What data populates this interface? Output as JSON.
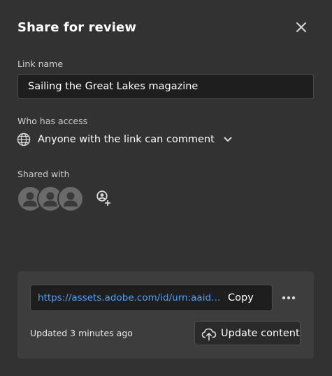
{
  "dialog": {
    "title": "Share for review",
    "close_icon": "close-icon"
  },
  "link_name": {
    "label": "Link name",
    "value": "Sailing the Great Lakes magazine"
  },
  "access": {
    "label": "Who has access",
    "value": "Anyone with the link can comment",
    "icon": "globe-icon"
  },
  "shared_with": {
    "label": "Shared with",
    "avatar_count": 3,
    "add_icon": "add-user-icon"
  },
  "share_panel": {
    "url": "https://assets.adobe.com/id/urn:aaid:s...",
    "copy_label": "Copy",
    "more_icon": "more-icon",
    "updated_text": "Updated 3 minutes ago",
    "update_label": "Update content",
    "update_icon": "cloud-upload-icon"
  },
  "colors": {
    "background": "#323232",
    "panel": "#3d3d3d",
    "field": "#1e1e1e",
    "link": "#4ea1f5"
  }
}
